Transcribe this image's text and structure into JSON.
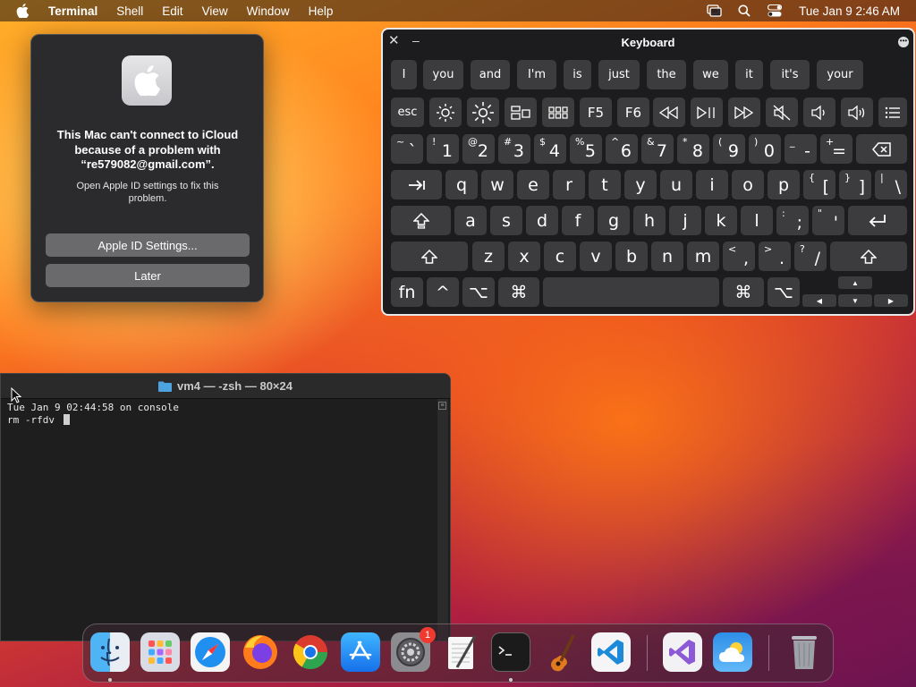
{
  "menubar": {
    "app_name": "Terminal",
    "items": [
      "Shell",
      "Edit",
      "View",
      "Window",
      "Help"
    ],
    "clock": "Tue Jan 9  2:46 AM",
    "status_icons": [
      "screen-mirroring-icon",
      "search-icon",
      "control-center-icon"
    ]
  },
  "dialog": {
    "title": "This Mac can't connect to iCloud because of a problem with “re579082@gmail.com”.",
    "body": "Open Apple ID settings to fix this problem.",
    "primary_button": "Apple ID Settings...",
    "secondary_button": "Later"
  },
  "keyboard": {
    "title": "Keyboard",
    "suggestions": [
      "I",
      "you",
      "and",
      "I'm",
      "is",
      "just",
      "the",
      "we",
      "it",
      "it's",
      "your"
    ],
    "fn_row": {
      "esc": "esc",
      "f5": "F5",
      "f6": "F6"
    },
    "number_row": [
      {
        "shift": "~",
        "base": "`"
      },
      {
        "shift": "!",
        "base": "1"
      },
      {
        "shift": "@",
        "base": "2"
      },
      {
        "shift": "#",
        "base": "3"
      },
      {
        "shift": "$",
        "base": "4"
      },
      {
        "shift": "%",
        "base": "5"
      },
      {
        "shift": "^",
        "base": "6"
      },
      {
        "shift": "&",
        "base": "7"
      },
      {
        "shift": "*",
        "base": "8"
      },
      {
        "shift": "(",
        "base": "9"
      },
      {
        "shift": ")",
        "base": "0"
      },
      {
        "shift": "_",
        "base": "-"
      },
      {
        "shift": "+",
        "base": "="
      }
    ],
    "row_q": [
      "q",
      "w",
      "e",
      "r",
      "t",
      "y",
      "u",
      "i",
      "o",
      "p"
    ],
    "row_q_punct": [
      {
        "shift": "{",
        "base": "["
      },
      {
        "shift": "}",
        "base": "]"
      },
      {
        "shift": "|",
        "base": "\\"
      }
    ],
    "row_a": [
      "a",
      "s",
      "d",
      "f",
      "g",
      "h",
      "j",
      "k",
      "l"
    ],
    "row_a_punct": [
      {
        "shift": ":",
        "base": ";"
      },
      {
        "shift": "\"",
        "base": "'"
      }
    ],
    "row_z": [
      "z",
      "x",
      "c",
      "v",
      "b",
      "n",
      "m"
    ],
    "row_z_punct": [
      {
        "shift": "<",
        "base": ","
      },
      {
        "shift": ">",
        "base": "."
      },
      {
        "shift": "?",
        "base": "/"
      }
    ],
    "bottom_row": {
      "fn": "fn",
      "control": "^",
      "option": "⌥",
      "command": "⌘"
    },
    "arrows": {
      "up": "▲",
      "left": "◀",
      "down": "▼",
      "right": "▶"
    }
  },
  "terminal": {
    "title": "vm4 — -zsh — 80×24",
    "lines": [
      "Tue Jan  9 02:44:58 on console",
      "rm -rfdv "
    ]
  },
  "dock": {
    "apps": [
      "finder",
      "launchpad",
      "safari",
      "firefox",
      "chrome",
      "app-store",
      "system-settings",
      "textedit",
      "terminal",
      "garageband",
      "vscode",
      "visual-studio",
      "weather",
      "trash"
    ],
    "system_settings_badge": "1"
  }
}
